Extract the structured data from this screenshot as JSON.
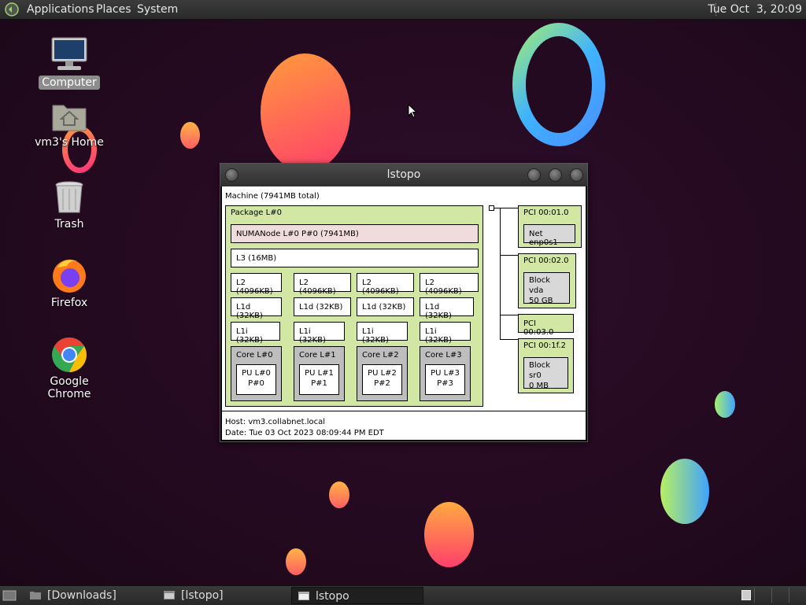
{
  "top_panel": {
    "menus": [
      "Applications",
      "Places",
      "System"
    ],
    "clock": "Tue Oct  3, 20:09"
  },
  "desktop_icons": [
    {
      "label": "Computer"
    },
    {
      "label": "vm3's Home"
    },
    {
      "label": "Trash"
    },
    {
      "label": "Firefox"
    },
    {
      "label": "Google Chrome"
    }
  ],
  "window": {
    "title": "lstopo",
    "machine": "Machine (7941MB total)",
    "package": "Package L#0",
    "numa": "NUMANode L#0 P#0 (7941MB)",
    "l3": "L3 (16MB)",
    "l2": [
      "L2 (4096KB)",
      "L2 (4096KB)",
      "L2 (4096KB)",
      "L2 (4096KB)"
    ],
    "l1d": [
      "L1d (32KB)",
      "L1d (32KB)",
      "L1d (32KB)",
      "L1d (32KB)"
    ],
    "l1i": [
      "L1i (32KB)",
      "L1i (32KB)",
      "L1i (32KB)",
      "L1i (32KB)"
    ],
    "cores": [
      {
        "name": "Core L#0",
        "pu1": "PU L#0",
        "pu2": "P#0"
      },
      {
        "name": "Core L#1",
        "pu1": "PU L#1",
        "pu2": "P#1"
      },
      {
        "name": "Core L#2",
        "pu1": "PU L#2",
        "pu2": "P#2"
      },
      {
        "name": "Core L#3",
        "pu1": "PU L#3",
        "pu2": "P#3"
      }
    ],
    "pci": [
      {
        "label": "PCI 00:01.0",
        "child1": "Net enp0s1",
        "child2": ""
      },
      {
        "label": "PCI 00:02.0",
        "child1": "Block vda",
        "child2": "50 GB"
      },
      {
        "label": "PCI 00:03.0",
        "child1": "",
        "child2": ""
      },
      {
        "label": "PCI 00:1f.2",
        "child1": "Block sr0",
        "child2": "0 MB"
      }
    ],
    "host": "Host: vm3.collabnet.local",
    "date": "Date: Tue 03 Oct 2023 08:09:44 PM EDT"
  },
  "taskbar": [
    {
      "label": "[Downloads]",
      "active": false
    },
    {
      "label": "[lstopo]",
      "active": false
    },
    {
      "label": "lstopo",
      "active": true
    }
  ],
  "colors": {
    "package_green": "#d2e7a4",
    "numa_pink": "#f0dcdc",
    "core_gray": "#bebebe",
    "desktop_bg": "#240a20"
  }
}
